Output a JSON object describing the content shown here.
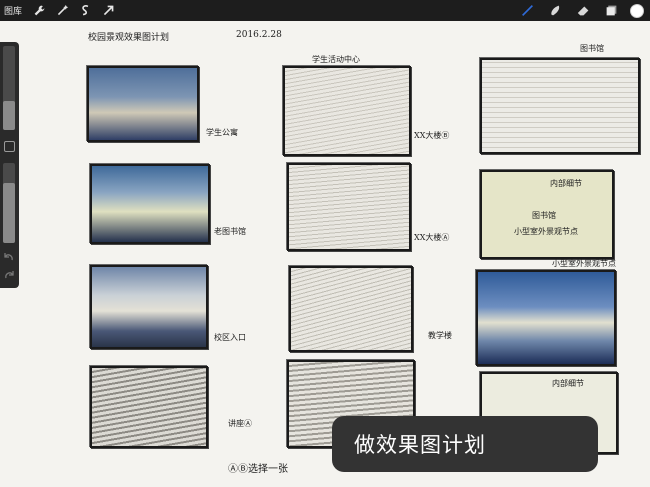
{
  "toolbar": {
    "gallery_label": "图库",
    "left_tools": [
      "wrench-icon",
      "magic-wand-icon",
      "selection-icon",
      "transform-arrow-icon"
    ],
    "right_tools": [
      "brush-icon",
      "smudge-icon",
      "eraser-icon",
      "layers-icon"
    ],
    "active_color": "#ffffff",
    "accent_color": "#2f6bd8"
  },
  "sidebar": {
    "size_level": 0.35,
    "opacity_level": 0.75
  },
  "sheet": {
    "title": "校园景观效果图计划",
    "date": "2016.2.28",
    "notes": {
      "row1_left": "学生公寓",
      "row1_right": "XX大楼Ⓑ",
      "row2_left": "老图书馆",
      "row2_right": "XX大楼Ⓐ",
      "row3_left": "校区入口",
      "row3_mid": "教学楼",
      "row4_left": "讲座Ⓐ",
      "footer": "ⒶⒷ选择一张",
      "top_mid": "学生活动中心",
      "top_right": "图书馆",
      "col3_r2_a": "内部细节",
      "col3_r2_b": "图书馆",
      "col3_r2_c": "小型室外景观节点",
      "col3_r3_top": "小型室外景观节点",
      "col3_r4": "内部细节"
    }
  },
  "caption": "做效果图计划"
}
